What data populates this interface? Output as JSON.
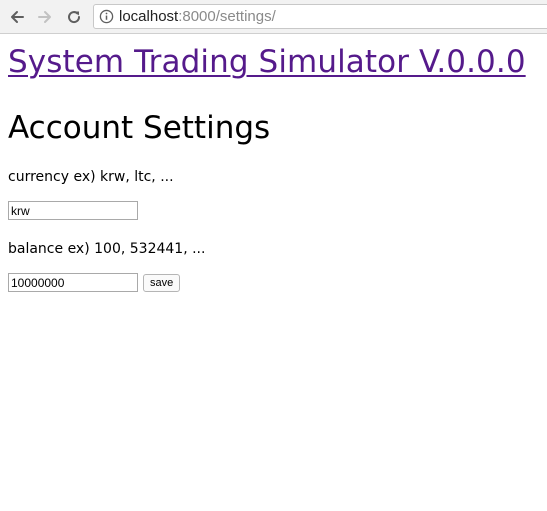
{
  "browser": {
    "url_host": "localhost",
    "url_rest": ":8000/settings/"
  },
  "page": {
    "site_title": "System Trading Simulator V.0.0.0",
    "heading": "Account Settings",
    "currency": {
      "label": "currency ex) krw, ltc, ...",
      "value": "krw"
    },
    "balance": {
      "label": "balance ex) 100, 532441, ...",
      "value": "10000000"
    },
    "save_label": "save"
  },
  "colors": {
    "link_visited": "#551a8b"
  },
  "icons": [
    "back-arrow-icon",
    "forward-arrow-icon",
    "reload-icon",
    "info-icon"
  ]
}
